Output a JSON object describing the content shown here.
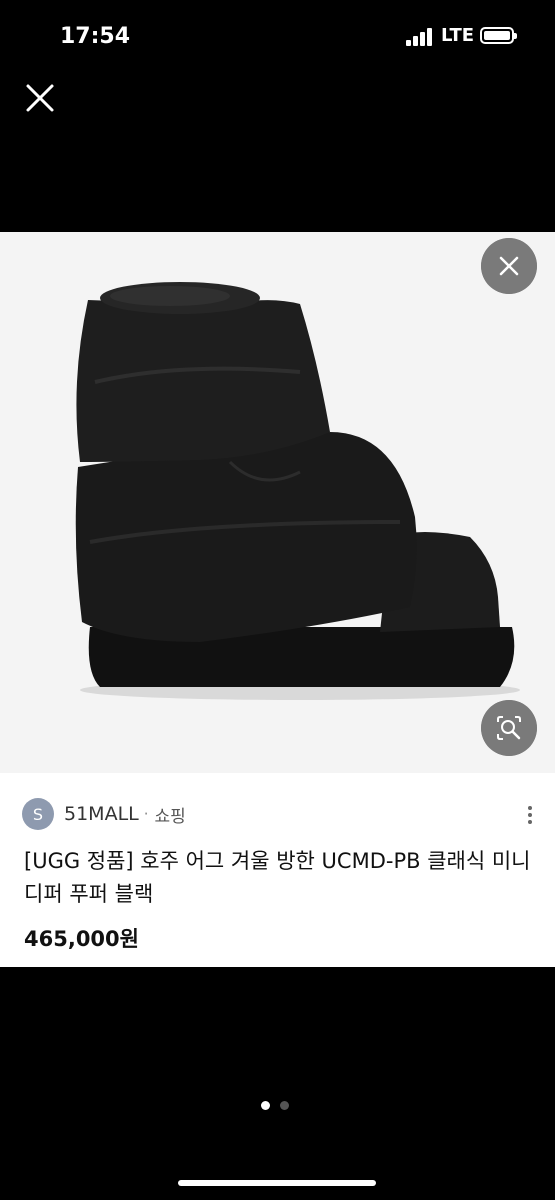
{
  "status_bar": {
    "time": "17:54",
    "network": "LTE",
    "icons": [
      "signal-icon",
      "battery-icon"
    ]
  },
  "viewer": {
    "close_icon": "close-icon",
    "image_close_icon": "close-icon",
    "lens_icon": "image-search-icon",
    "image_subject": "black puffer platform boot"
  },
  "product": {
    "store_initial": "S",
    "store_name": "51MALL",
    "separator": "·",
    "category": "쇼핑",
    "title": "[UGG 정품] 호주 어그 겨울 방한 UCMD-PB 클래식 미니 디퍼 푸퍼 블랙",
    "price": "465,000원"
  },
  "pager": {
    "total": 2,
    "active": 1
  },
  "colors": {
    "background": "#000000",
    "image_bg": "#f4f4f4",
    "overlay_button": "#7a7a7a",
    "avatar": "#8e9aaf"
  }
}
